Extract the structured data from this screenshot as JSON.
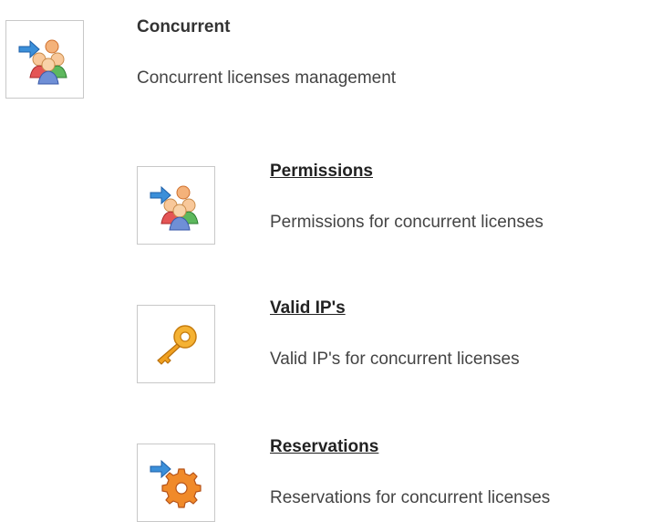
{
  "header": {
    "title": "Concurrent",
    "description": "Concurrent licenses management",
    "icon": "users-arrow-icon"
  },
  "items": [
    {
      "title": "Permissions",
      "description": "Permissions for concurrent licenses",
      "icon": "users-arrow-icon"
    },
    {
      "title": "Valid IP's",
      "description": "Valid IP's for concurrent licenses",
      "icon": "key-icon"
    },
    {
      "title": "Reservations",
      "description": "Reservations for concurrent licenses",
      "icon": "gear-arrow-icon"
    }
  ],
  "colors": {
    "icon_border": "#c8c8c8",
    "arrow_blue": "#3b8fd9",
    "key_orange": "#f0a020",
    "gear_orange": "#e8741a"
  }
}
